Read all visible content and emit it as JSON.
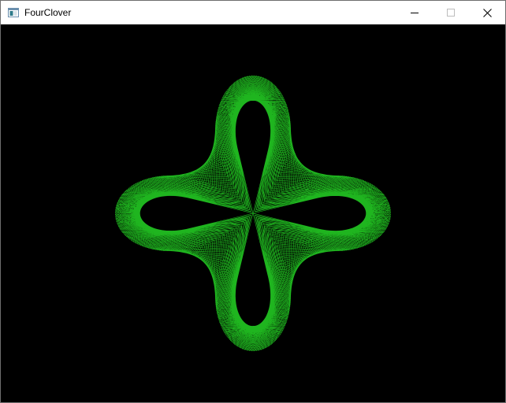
{
  "window": {
    "title": "FourClover"
  },
  "icons": {
    "app": "app-window-icon",
    "minimize": "minimize-icon",
    "maximize": "maximize-icon",
    "close": "close-icon"
  },
  "colors": {
    "background": "#000000",
    "stroke": "#1fb51f",
    "titlebar": "#ffffff"
  }
}
